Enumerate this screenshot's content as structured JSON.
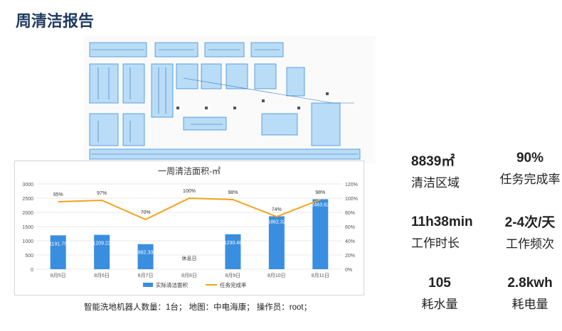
{
  "title": "周清洁报告",
  "footer": "智能洗地机器人数量：1台；  地图：中电海康；  操作员：root；",
  "stats": {
    "area": {
      "value": "8839㎡",
      "label": "清洁区域"
    },
    "completion": {
      "value": "90%",
      "label": "任务完成率"
    },
    "duration": {
      "value": "11h38min",
      "label": "工作时长"
    },
    "frequency": {
      "value": "2-4次/天",
      "label": "工作频次"
    },
    "water": {
      "value": "105",
      "label": "耗水量"
    },
    "power": {
      "value": "2.8kwh",
      "label": "耗电量"
    }
  },
  "chart_data": {
    "type": "bar",
    "title": "一周清洁面积-㎡",
    "categories": [
      "8月5日",
      "8月6日",
      "8月7日",
      "8月8日",
      "8月9日",
      "8月10日",
      "8月11日"
    ],
    "series": [
      {
        "name": "实际清洁面积",
        "type": "bar",
        "axis": "left",
        "color": "#3a8ee0",
        "values": [
          1191.75,
          1209.22,
          882.33,
          null,
          1230.48,
          1862.32,
          2463.62
        ],
        "labels": [
          "1191.75",
          "1209.22",
          "882.33",
          "",
          "1230.48",
          "1862.32",
          "2463.62"
        ]
      },
      {
        "name": "任务完成率",
        "type": "line",
        "axis": "right",
        "color": "#f5a21b",
        "values": [
          95,
          97,
          70,
          100,
          98,
          74,
          98
        ],
        "labels": [
          "95%",
          "97%",
          "70%",
          "100%",
          "98%",
          "74%",
          "98%"
        ]
      }
    ],
    "annotation": "休息日",
    "ylim": [
      0,
      3000
    ],
    "y_ticks": [
      "0",
      "500",
      "1000",
      "1500",
      "2000",
      "2500",
      "3000"
    ],
    "y2lim": [
      0,
      120
    ],
    "y2_ticks": [
      "0%",
      "20%",
      "40%",
      "60%",
      "80%",
      "100%",
      "120%"
    ],
    "grid": true,
    "legend": "bottom"
  }
}
